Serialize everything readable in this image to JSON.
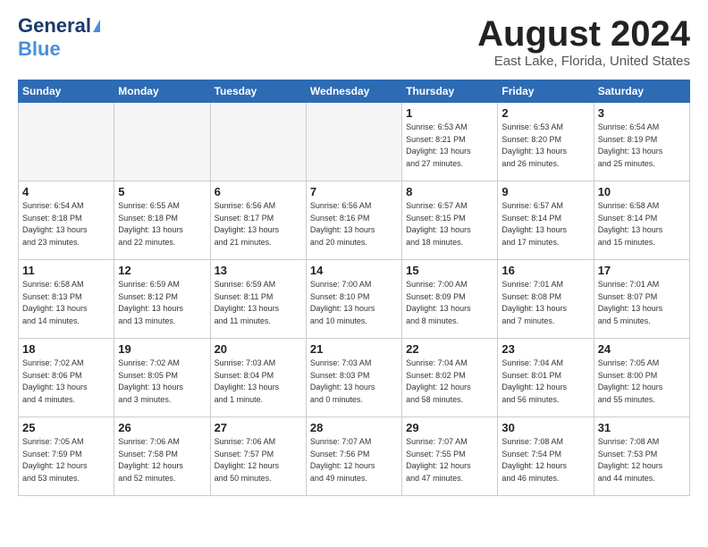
{
  "header": {
    "logo_general": "General",
    "logo_blue": "Blue",
    "month": "August 2024",
    "location": "East Lake, Florida, United States"
  },
  "weekdays": [
    "Sunday",
    "Monday",
    "Tuesday",
    "Wednesday",
    "Thursday",
    "Friday",
    "Saturday"
  ],
  "weeks": [
    [
      {
        "day": "",
        "info": "",
        "empty": true
      },
      {
        "day": "",
        "info": "",
        "empty": true
      },
      {
        "day": "",
        "info": "",
        "empty": true
      },
      {
        "day": "",
        "info": "",
        "empty": true
      },
      {
        "day": "1",
        "info": "Sunrise: 6:53 AM\nSunset: 8:21 PM\nDaylight: 13 hours\nand 27 minutes."
      },
      {
        "day": "2",
        "info": "Sunrise: 6:53 AM\nSunset: 8:20 PM\nDaylight: 13 hours\nand 26 minutes."
      },
      {
        "day": "3",
        "info": "Sunrise: 6:54 AM\nSunset: 8:19 PM\nDaylight: 13 hours\nand 25 minutes."
      }
    ],
    [
      {
        "day": "4",
        "info": "Sunrise: 6:54 AM\nSunset: 8:18 PM\nDaylight: 13 hours\nand 23 minutes."
      },
      {
        "day": "5",
        "info": "Sunrise: 6:55 AM\nSunset: 8:18 PM\nDaylight: 13 hours\nand 22 minutes."
      },
      {
        "day": "6",
        "info": "Sunrise: 6:56 AM\nSunset: 8:17 PM\nDaylight: 13 hours\nand 21 minutes."
      },
      {
        "day": "7",
        "info": "Sunrise: 6:56 AM\nSunset: 8:16 PM\nDaylight: 13 hours\nand 20 minutes."
      },
      {
        "day": "8",
        "info": "Sunrise: 6:57 AM\nSunset: 8:15 PM\nDaylight: 13 hours\nand 18 minutes."
      },
      {
        "day": "9",
        "info": "Sunrise: 6:57 AM\nSunset: 8:14 PM\nDaylight: 13 hours\nand 17 minutes."
      },
      {
        "day": "10",
        "info": "Sunrise: 6:58 AM\nSunset: 8:14 PM\nDaylight: 13 hours\nand 15 minutes."
      }
    ],
    [
      {
        "day": "11",
        "info": "Sunrise: 6:58 AM\nSunset: 8:13 PM\nDaylight: 13 hours\nand 14 minutes."
      },
      {
        "day": "12",
        "info": "Sunrise: 6:59 AM\nSunset: 8:12 PM\nDaylight: 13 hours\nand 13 minutes."
      },
      {
        "day": "13",
        "info": "Sunrise: 6:59 AM\nSunset: 8:11 PM\nDaylight: 13 hours\nand 11 minutes."
      },
      {
        "day": "14",
        "info": "Sunrise: 7:00 AM\nSunset: 8:10 PM\nDaylight: 13 hours\nand 10 minutes."
      },
      {
        "day": "15",
        "info": "Sunrise: 7:00 AM\nSunset: 8:09 PM\nDaylight: 13 hours\nand 8 minutes."
      },
      {
        "day": "16",
        "info": "Sunrise: 7:01 AM\nSunset: 8:08 PM\nDaylight: 13 hours\nand 7 minutes."
      },
      {
        "day": "17",
        "info": "Sunrise: 7:01 AM\nSunset: 8:07 PM\nDaylight: 13 hours\nand 5 minutes."
      }
    ],
    [
      {
        "day": "18",
        "info": "Sunrise: 7:02 AM\nSunset: 8:06 PM\nDaylight: 13 hours\nand 4 minutes."
      },
      {
        "day": "19",
        "info": "Sunrise: 7:02 AM\nSunset: 8:05 PM\nDaylight: 13 hours\nand 3 minutes."
      },
      {
        "day": "20",
        "info": "Sunrise: 7:03 AM\nSunset: 8:04 PM\nDaylight: 13 hours\nand 1 minute."
      },
      {
        "day": "21",
        "info": "Sunrise: 7:03 AM\nSunset: 8:03 PM\nDaylight: 13 hours\nand 0 minutes."
      },
      {
        "day": "22",
        "info": "Sunrise: 7:04 AM\nSunset: 8:02 PM\nDaylight: 12 hours\nand 58 minutes."
      },
      {
        "day": "23",
        "info": "Sunrise: 7:04 AM\nSunset: 8:01 PM\nDaylight: 12 hours\nand 56 minutes."
      },
      {
        "day": "24",
        "info": "Sunrise: 7:05 AM\nSunset: 8:00 PM\nDaylight: 12 hours\nand 55 minutes."
      }
    ],
    [
      {
        "day": "25",
        "info": "Sunrise: 7:05 AM\nSunset: 7:59 PM\nDaylight: 12 hours\nand 53 minutes."
      },
      {
        "day": "26",
        "info": "Sunrise: 7:06 AM\nSunset: 7:58 PM\nDaylight: 12 hours\nand 52 minutes."
      },
      {
        "day": "27",
        "info": "Sunrise: 7:06 AM\nSunset: 7:57 PM\nDaylight: 12 hours\nand 50 minutes."
      },
      {
        "day": "28",
        "info": "Sunrise: 7:07 AM\nSunset: 7:56 PM\nDaylight: 12 hours\nand 49 minutes."
      },
      {
        "day": "29",
        "info": "Sunrise: 7:07 AM\nSunset: 7:55 PM\nDaylight: 12 hours\nand 47 minutes."
      },
      {
        "day": "30",
        "info": "Sunrise: 7:08 AM\nSunset: 7:54 PM\nDaylight: 12 hours\nand 46 minutes."
      },
      {
        "day": "31",
        "info": "Sunrise: 7:08 AM\nSunset: 7:53 PM\nDaylight: 12 hours\nand 44 minutes."
      }
    ]
  ]
}
